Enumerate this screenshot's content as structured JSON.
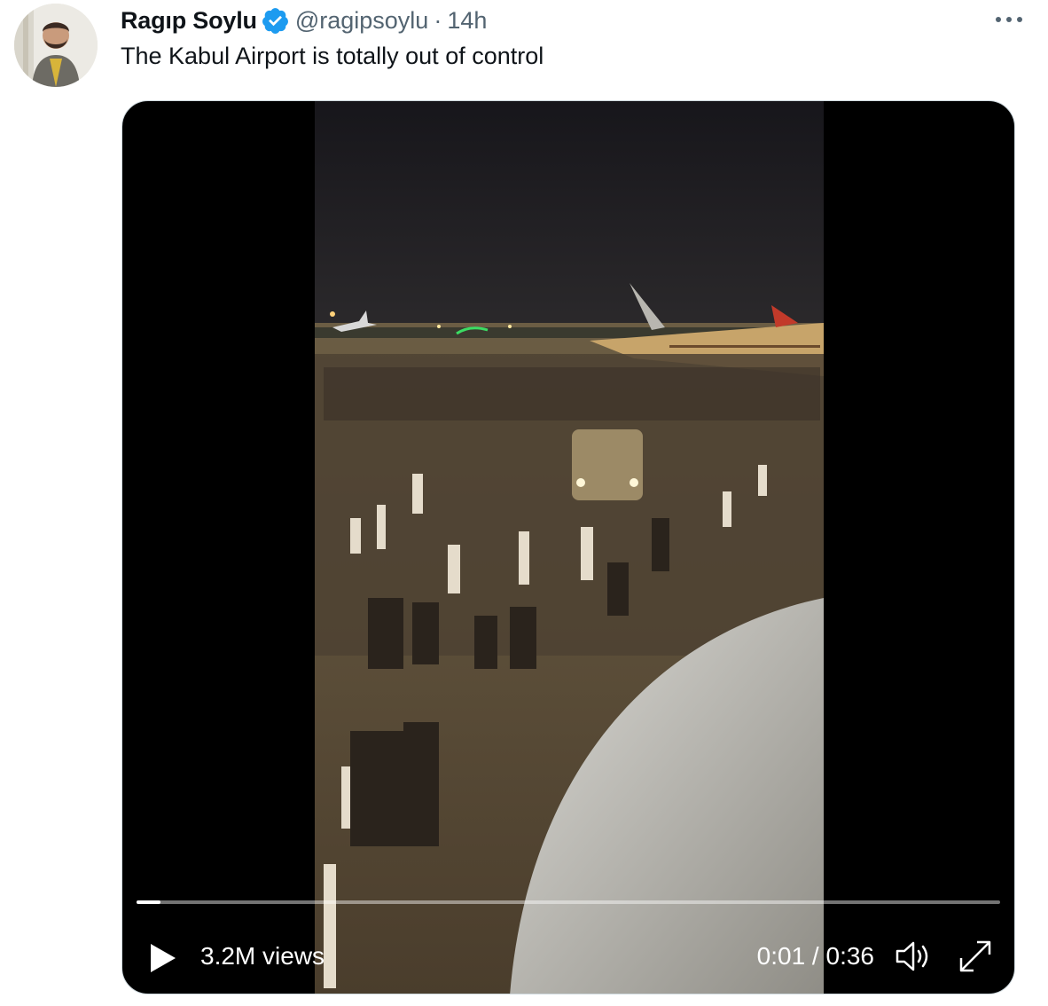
{
  "tweet": {
    "author": {
      "display_name": "Ragıp Soylu",
      "handle": "@ragipsoylu",
      "verified": true
    },
    "separator": "·",
    "time": "14h",
    "text": "The Kabul Airport is totally out of control"
  },
  "video": {
    "views": "3.2M views",
    "current_time": "0:01",
    "duration": "0:36",
    "time_separator": " / ",
    "progress": 0.028
  },
  "icons": {
    "verified": "verified-badge-icon",
    "more": "more-options-icon",
    "play": "play-icon",
    "volume": "volume-icon",
    "fullscreen": "fullscreen-icon"
  },
  "colors": {
    "accent": "#1d9bf0",
    "text_primary": "#0f1419",
    "text_secondary": "#536471"
  }
}
